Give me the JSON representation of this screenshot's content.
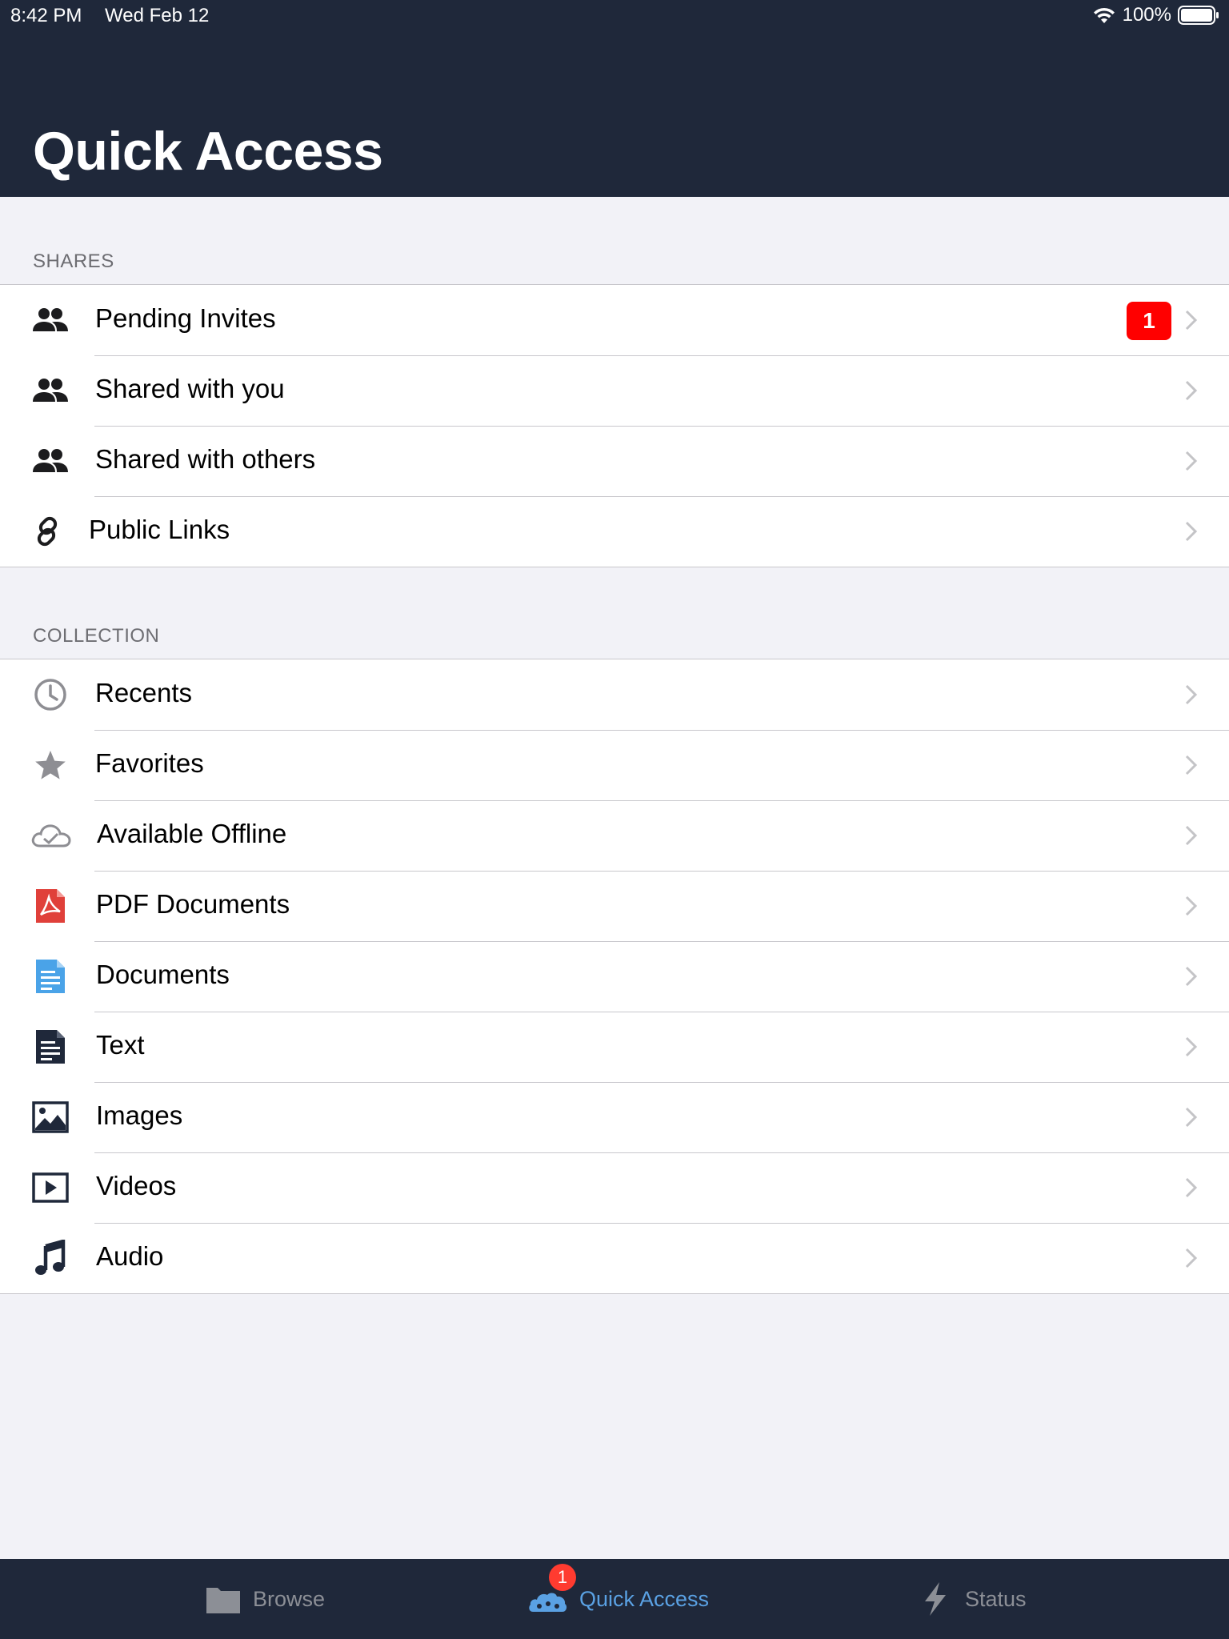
{
  "status_bar": {
    "time": "8:42 PM",
    "date": "Wed Feb 12",
    "battery": "100%"
  },
  "header": {
    "title": "Quick Access"
  },
  "sections": {
    "shares": {
      "title": "SHARES",
      "items": [
        {
          "label": "Pending Invites",
          "icon": "people-icon",
          "badge": "1"
        },
        {
          "label": "Shared with you",
          "icon": "people-icon"
        },
        {
          "label": "Shared with others",
          "icon": "people-icon"
        },
        {
          "label": "Public Links",
          "icon": "link-icon"
        }
      ]
    },
    "collection": {
      "title": "COLLECTION",
      "items": [
        {
          "label": "Recents",
          "icon": "clock-icon"
        },
        {
          "label": "Favorites",
          "icon": "star-icon"
        },
        {
          "label": "Available Offline",
          "icon": "cloud-check-icon"
        },
        {
          "label": "PDF Documents",
          "icon": "pdf-icon"
        },
        {
          "label": "Documents",
          "icon": "document-icon"
        },
        {
          "label": "Text",
          "icon": "text-file-icon"
        },
        {
          "label": "Images",
          "icon": "image-icon"
        },
        {
          "label": "Videos",
          "icon": "video-icon"
        },
        {
          "label": "Audio",
          "icon": "music-note-icon"
        }
      ]
    }
  },
  "tab_bar": {
    "tabs": [
      {
        "label": "Browse",
        "icon": "folder-icon",
        "active": false
      },
      {
        "label": "Quick Access",
        "icon": "cloud-icon",
        "active": true,
        "badge": "1"
      },
      {
        "label": "Status",
        "icon": "lightning-icon",
        "active": false
      }
    ]
  },
  "colors": {
    "header_bg": "#1f283a",
    "badge_red": "#ff0000",
    "tab_active": "#5aa1e3",
    "tab_inactive": "#8c8f96",
    "pdf_red": "#e0403a",
    "doc_blue": "#4aa3e8"
  }
}
